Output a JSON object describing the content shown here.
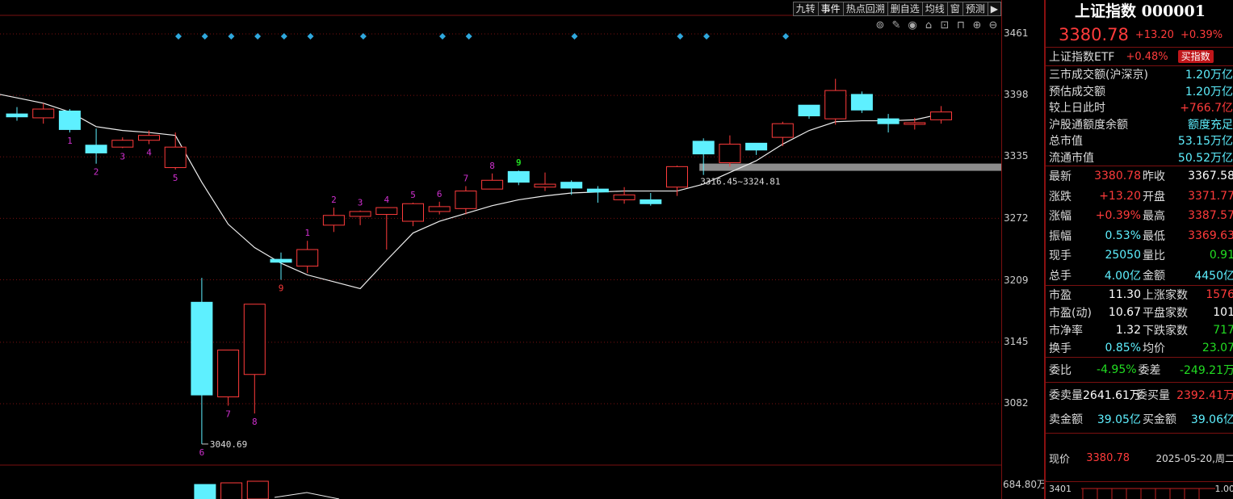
{
  "toolbar": {
    "buttons": [
      "九转",
      "事件",
      "热点回溯",
      "删自选",
      "均线",
      "窗",
      "预测"
    ],
    "active": "事件"
  },
  "tool_icons": [
    "target-icon",
    "pencil-icon",
    "eye-icon",
    "lock-icon",
    "bag-icon",
    "lock-open-icon",
    "zoom-in-icon",
    "zoom-out-icon"
  ],
  "price_axis": [
    "3461",
    "3398",
    "3335",
    "3272",
    "3209",
    "3145",
    "3082"
  ],
  "volume_axis_label": "684.80万",
  "annotations": {
    "low": "3040.69",
    "gap": "3316.45~3324.81"
  },
  "chart_data": {
    "type": "candlestick",
    "ylim": [
      3000,
      3480
    ],
    "candles": [
      {
        "o": 3379,
        "c": 3376,
        "h": 3386,
        "l": 3372,
        "up": false,
        "label": "",
        "lc": ""
      },
      {
        "o": 3375,
        "c": 3384,
        "h": 3390,
        "l": 3369,
        "up": true,
        "label": "",
        "lc": ""
      },
      {
        "o": 3382,
        "c": 3363,
        "h": 3384,
        "l": 3360,
        "up": false,
        "label": "1",
        "lc": "#d030d0"
      },
      {
        "o": 3347,
        "c": 3339,
        "h": 3364,
        "l": 3328,
        "up": false,
        "label": "2",
        "lc": "#d030d0"
      },
      {
        "o": 3345,
        "c": 3352,
        "h": 3355,
        "l": 3344,
        "up": true,
        "label": "3",
        "lc": "#d030d0"
      },
      {
        "o": 3352,
        "c": 3357,
        "h": 3362,
        "l": 3348,
        "up": true,
        "label": "4",
        "lc": "#d030d0"
      },
      {
        "o": 3324,
        "c": 3345,
        "h": 3360,
        "l": 3322,
        "up": true,
        "label": "5",
        "lc": "#d030d0"
      },
      {
        "o": 3186,
        "c": 3091,
        "h": 3211,
        "l": 3040.69,
        "up": false,
        "label": "6",
        "lc": "#d030d0"
      },
      {
        "o": 3089,
        "c": 3137,
        "h": 3137,
        "l": 3080,
        "up": true,
        "label": "7",
        "lc": "#d030d0"
      },
      {
        "o": 3112,
        "c": 3184,
        "h": 3184,
        "l": 3072,
        "up": true,
        "label": "8",
        "lc": "#d030d0"
      },
      {
        "o": 3230,
        "c": 3227,
        "h": 3237,
        "l": 3209,
        "up": false,
        "label": "9",
        "lc": "#ff3b3b",
        "below": true
      },
      {
        "o": 3223,
        "c": 3240,
        "h": 3249,
        "l": 3216,
        "up": true,
        "label": "1",
        "lc": "#d030d0"
      },
      {
        "o": 3265,
        "c": 3275,
        "h": 3283,
        "l": 3258,
        "up": true,
        "label": "2",
        "lc": "#d030d0"
      },
      {
        "o": 3274,
        "c": 3279,
        "h": 3280,
        "l": 3265,
        "up": true,
        "label": "3",
        "lc": "#d030d0"
      },
      {
        "o": 3276,
        "c": 3283,
        "h": 3283,
        "l": 3240,
        "up": true,
        "label": "4",
        "lc": "#d030d0"
      },
      {
        "o": 3269,
        "c": 3287,
        "h": 3288,
        "l": 3264,
        "up": true,
        "label": "5",
        "lc": "#d030d0"
      },
      {
        "o": 3279,
        "c": 3284,
        "h": 3289,
        "l": 3276,
        "up": true,
        "label": "6",
        "lc": "#d030d0"
      },
      {
        "o": 3282,
        "c": 3300,
        "h": 3305,
        "l": 3276,
        "up": true,
        "label": "7",
        "lc": "#d030d0"
      },
      {
        "o": 3302,
        "c": 3311,
        "h": 3318,
        "l": 3302,
        "up": true,
        "label": "8",
        "lc": "#d030d0"
      },
      {
        "o": 3320,
        "c": 3309,
        "h": 3321,
        "l": 3306,
        "up": false,
        "label": "9",
        "lc": "#22dd22"
      },
      {
        "o": 3304,
        "c": 3307,
        "h": 3319,
        "l": 3300,
        "up": true,
        "label": "",
        "lc": ""
      },
      {
        "o": 3309,
        "c": 3303,
        "h": 3311,
        "l": 3296,
        "up": false,
        "label": "",
        "lc": ""
      },
      {
        "o": 3302,
        "c": 3299,
        "h": 3305,
        "l": 3288,
        "up": false,
        "label": "",
        "lc": ""
      },
      {
        "o": 3291,
        "c": 3296,
        "h": 3304,
        "l": 3287,
        "up": true,
        "label": "",
        "lc": ""
      },
      {
        "o": 3291,
        "c": 3287,
        "h": 3298,
        "l": 3285,
        "up": false,
        "label": "",
        "lc": ""
      },
      {
        "o": 3304,
        "c": 3325,
        "h": 3326,
        "l": 3295,
        "up": true,
        "label": "",
        "lc": ""
      },
      {
        "o": 3351,
        "c": 3338,
        "h": 3354,
        "l": 3316.45,
        "up": false,
        "label": "",
        "lc": ""
      },
      {
        "o": 3329,
        "c": 3348,
        "h": 3357,
        "l": 3325,
        "up": true,
        "label": "",
        "lc": ""
      },
      {
        "o": 3349,
        "c": 3342,
        "h": 3349,
        "l": 3337,
        "up": false,
        "label": "",
        "lc": ""
      },
      {
        "o": 3355,
        "c": 3369,
        "h": 3371,
        "l": 3346,
        "up": true,
        "label": "",
        "lc": ""
      },
      {
        "o": 3388,
        "c": 3377,
        "h": 3388,
        "l": 3374,
        "up": false,
        "label": "",
        "lc": ""
      },
      {
        "o": 3374,
        "c": 3403,
        "h": 3415,
        "l": 3368,
        "up": true,
        "label": "",
        "lc": ""
      },
      {
        "o": 3399,
        "c": 3383,
        "h": 3402,
        "l": 3380,
        "up": false,
        "label": "",
        "lc": ""
      },
      {
        "o": 3374,
        "c": 3369,
        "h": 3379,
        "l": 3360,
        "up": false,
        "label": "",
        "lc": ""
      },
      {
        "o": 3369,
        "c": 3370,
        "h": 3375,
        "l": 3363,
        "up": true,
        "label": "",
        "lc": ""
      },
      {
        "o": 3373,
        "c": 3381,
        "h": 3387,
        "l": 3369,
        "up": true,
        "label": "",
        "lc": ""
      }
    ],
    "ma": [
      3399,
      3390,
      3381,
      3366,
      3362,
      3360,
      3357,
      3309,
      3266,
      3242,
      3226,
      3214,
      3207,
      3200,
      3229,
      3257,
      3269,
      3277,
      3285,
      3291,
      3295,
      3298,
      3299,
      3300,
      3300,
      3300,
      3307,
      3319,
      3331,
      3348,
      3362,
      3371,
      3372,
      3372,
      3373,
      3379
    ],
    "event_markers": [
      0,
      1,
      2,
      3,
      4,
      5,
      7,
      10,
      11,
      15,
      19,
      20,
      23
    ],
    "volume": [
      {
        "v": 0.78,
        "up": false
      },
      {
        "v": 0.72,
        "up": true
      },
      {
        "v": 0.8,
        "up": true
      }
    ]
  },
  "panel": {
    "title": "上证指数 000001",
    "price": "3380.78",
    "change": "+13.20",
    "change_pct": "+0.39%",
    "etf_label": "上证指数ETF",
    "etf_pct": "+0.48%",
    "etf_btn": "买指数",
    "info": [
      {
        "k": "三市成交额(沪深京)",
        "v": "1.20万亿",
        "c": "cyan"
      },
      {
        "k": "预估成交额",
        "v": "1.20万亿",
        "c": "cyan"
      },
      {
        "k": "较上日此时",
        "v": "+766.7亿",
        "c": "red"
      },
      {
        "k": "沪股通额度余额",
        "v": "额度充足",
        "c": "cyan"
      },
      {
        "k": "总市值",
        "v": "53.15万亿",
        "c": "cyan"
      },
      {
        "k": "流通市值",
        "v": "50.52万亿",
        "c": "cyan"
      }
    ],
    "quote": [
      {
        "a": "最新",
        "b": "3380.78",
        "bc": "red",
        "c": "昨收",
        "d": "3367.58",
        "dc": "white"
      },
      {
        "a": "涨跌",
        "b": "+13.20",
        "bc": "red",
        "c": "开盘",
        "d": "3371.77",
        "dc": "red"
      },
      {
        "a": "涨幅",
        "b": "+0.39%",
        "bc": "red",
        "c": "最高",
        "d": "3387.57",
        "dc": "red"
      },
      {
        "a": "振幅",
        "b": "0.53%",
        "bc": "cyan",
        "c": "最低",
        "d": "3369.63",
        "dc": "red"
      },
      {
        "a": "现手",
        "b": "25050",
        "bc": "cyan",
        "c": "量比",
        "d": "0.91",
        "dc": "green"
      },
      {
        "a": "总手",
        "b": "4.00亿",
        "bc": "cyan",
        "c": "金额",
        "d": "4450亿",
        "dc": "cyan"
      }
    ],
    "stats": [
      {
        "a": "市盈",
        "b": "11.30",
        "bc": "white",
        "c": "上涨家数",
        "d": "1576",
        "dc": "red"
      },
      {
        "a": "市盈(动)",
        "b": "10.67",
        "bc": "white",
        "c": "平盘家数",
        "d": "101",
        "dc": "white"
      },
      {
        "a": "市净率",
        "b": "1.32",
        "bc": "white",
        "c": "下跌家数",
        "d": "717",
        "dc": "green"
      },
      {
        "a": "换手",
        "b": "0.85%",
        "bc": "cyan",
        "c": "均价",
        "d": "23.07",
        "dc": "green"
      }
    ],
    "order": [
      {
        "a": "委比",
        "b": "-4.95%",
        "bc": "green",
        "c": "委差",
        "d": "-249.21万",
        "dc": "green"
      }
    ],
    "order2": [
      {
        "a": "委卖量",
        "b": "2641.61万",
        "bc": "white",
        "c": "委买量",
        "d": "2392.41万",
        "dc": "red"
      },
      {
        "a": "卖金额",
        "b": "39.05亿",
        "bc": "cyan",
        "c": "买金额",
        "d": "39.06亿",
        "dc": "cyan"
      }
    ],
    "bottom": {
      "label": "现价",
      "price": "3380.78",
      "date": "2025-05-20,周二"
    },
    "mini": {
      "lo": "3401",
      "hi": "1.00"
    }
  }
}
